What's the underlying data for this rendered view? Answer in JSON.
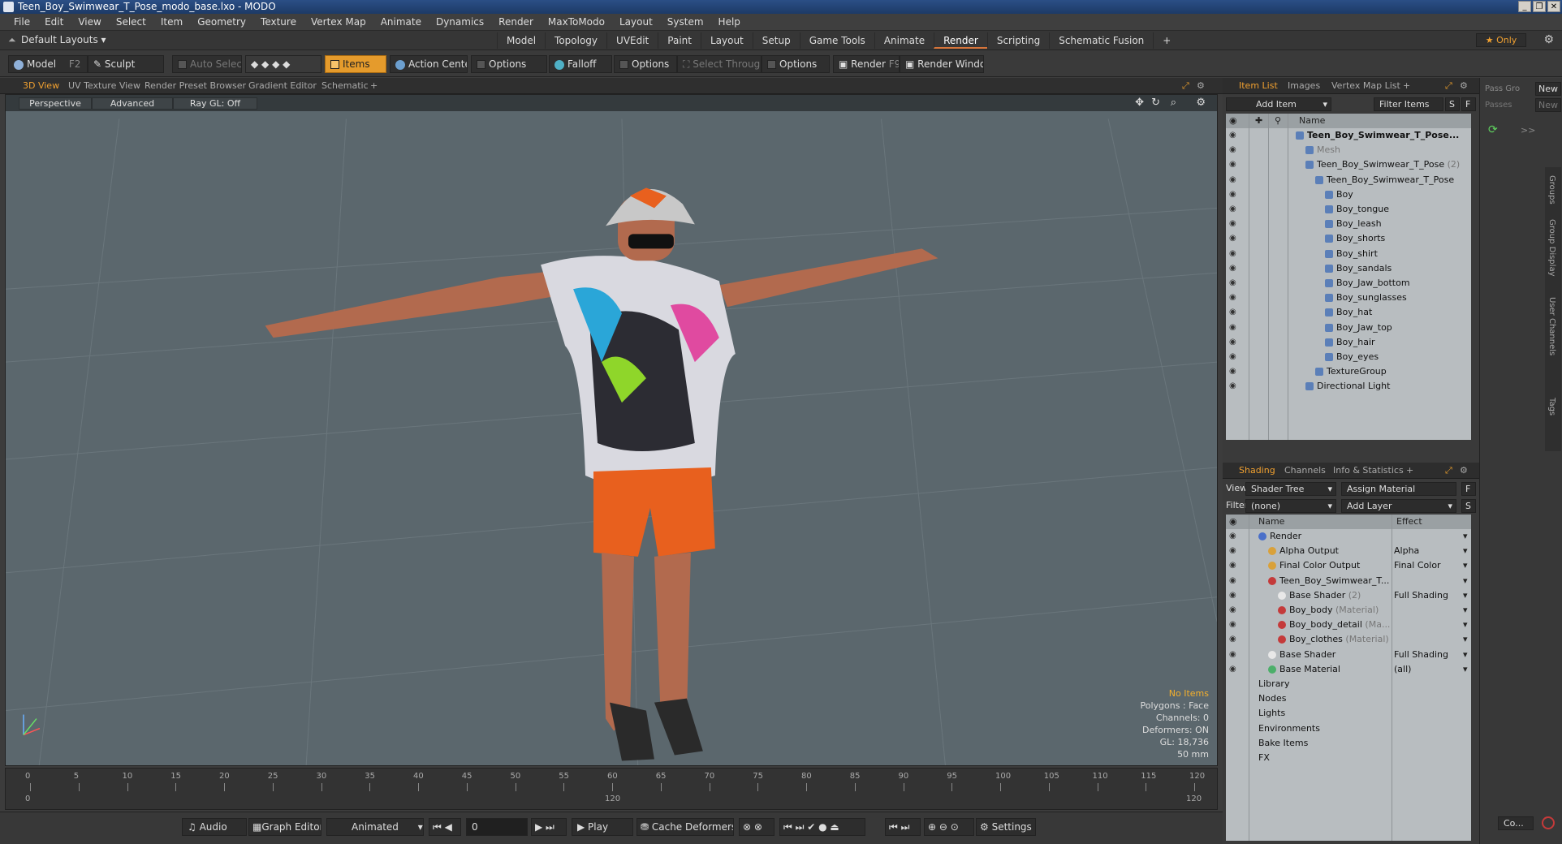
{
  "window": {
    "title": "Teen_Boy_Swimwear_T_Pose_modo_base.lxo - MODO",
    "controls": [
      "_",
      "❐",
      "✕"
    ]
  },
  "menu": [
    "File",
    "Edit",
    "View",
    "Select",
    "Item",
    "Geometry",
    "Texture",
    "Vertex Map",
    "Animate",
    "Dynamics",
    "Render",
    "MaxToModo",
    "Layout",
    "System",
    "Help"
  ],
  "layout": {
    "default": "Default Layouts ▾",
    "tabs": [
      "Model",
      "Topology",
      "UVEdit",
      "Paint",
      "Layout",
      "Setup",
      "Game Tools",
      "Animate",
      "Render",
      "Scripting",
      "Schematic Fusion",
      "+"
    ],
    "active_tab": "Render",
    "only": "★  Only"
  },
  "toolbar": {
    "model": "Model",
    "model_key": "F2",
    "sculpt": "Sculpt",
    "auto_select": "Auto Select",
    "items": "Items",
    "action_center": "Action Center",
    "options1": "Options",
    "falloff": "Falloff",
    "options2": "Options",
    "select_through": "Select Through",
    "options3": "Options",
    "render": "Render",
    "render_key": "F9",
    "render_window": "Render Window"
  },
  "viewtabs": [
    "3D View",
    "UV Texture View",
    "Render Preset Browser",
    "Gradient Editor",
    "Schematic",
    "+"
  ],
  "viewport": {
    "perspective": "Perspective",
    "advanced": "Advanced",
    "raygl": "Ray GL: Off",
    "info": {
      "no_items": "No Items",
      "polygons": "Polygons : Face",
      "channels": "Channels: 0",
      "deformers": "Deformers: ON",
      "gl": "GL: 18,736",
      "focal": "50 mm"
    }
  },
  "timeline": {
    "ticks": [
      "0",
      "5",
      "10",
      "15",
      "20",
      "25",
      "30",
      "35",
      "40",
      "45",
      "50",
      "55",
      "60",
      "65",
      "70",
      "75",
      "80",
      "85",
      "90",
      "95",
      "100",
      "105",
      "110",
      "115",
      "120"
    ],
    "start": "0",
    "mid": "120",
    "end": "120"
  },
  "bottom": {
    "audio": "Audio",
    "graph_editor": "Graph Editor",
    "animated": "Animated",
    "frame": "0",
    "play": "Play",
    "cache_deformers": "Cache Deformers",
    "settings": "Settings"
  },
  "item_list": {
    "tabs": [
      "Item List",
      "Images",
      "Vertex Map List",
      "+"
    ],
    "add_item": "Add Item",
    "filter_items": "Filter Items",
    "s": "S",
    "f": "F",
    "col_name": "Name",
    "items": [
      {
        "label": "Teen_Boy_Swimwear_T_Pose...",
        "suffix": "",
        "indent": 0,
        "bold": true
      },
      {
        "label": "Mesh",
        "suffix": "",
        "indent": 1,
        "dim": true
      },
      {
        "label": "Teen_Boy_Swimwear_T_Pose",
        "suffix": " (2)",
        "indent": 1
      },
      {
        "label": "Teen_Boy_Swimwear_T_Pose",
        "suffix": "",
        "indent": 2
      },
      {
        "label": "Boy",
        "suffix": "",
        "indent": 3
      },
      {
        "label": "Boy_tongue",
        "suffix": "",
        "indent": 3
      },
      {
        "label": "Boy_leash",
        "suffix": "",
        "indent": 3
      },
      {
        "label": "Boy_shorts",
        "suffix": "",
        "indent": 3
      },
      {
        "label": "Boy_shirt",
        "suffix": "",
        "indent": 3
      },
      {
        "label": "Boy_sandals",
        "suffix": "",
        "indent": 3
      },
      {
        "label": "Boy_Jaw_bottom",
        "suffix": "",
        "indent": 3
      },
      {
        "label": "Boy_sunglasses",
        "suffix": "",
        "indent": 3
      },
      {
        "label": "Boy_hat",
        "suffix": "",
        "indent": 3
      },
      {
        "label": "Boy_Jaw_top",
        "suffix": "",
        "indent": 3
      },
      {
        "label": "Boy_hair",
        "suffix": "",
        "indent": 3
      },
      {
        "label": "Boy_eyes",
        "suffix": "",
        "indent": 3
      },
      {
        "label": "TextureGroup",
        "suffix": "",
        "indent": 2
      },
      {
        "label": "Directional Light",
        "suffix": "",
        "indent": 1
      }
    ]
  },
  "shading": {
    "tabs": [
      "Shading",
      "Channels",
      "Info & Statistics",
      "+"
    ],
    "view_label": "View",
    "view_value": "Shader Tree",
    "assign_material": "Assign Material",
    "filter_label": "Filter",
    "filter_value": "(none)",
    "add_layer": "Add Layer",
    "f": "F",
    "s": "S",
    "col_name": "Name",
    "col_effect": "Effect",
    "rows": [
      {
        "label": "Render",
        "suffix": "",
        "effect": "",
        "indent": 0,
        "color": "#4a6fc9"
      },
      {
        "label": "Alpha Output",
        "suffix": "",
        "effect": "Alpha",
        "indent": 1,
        "color": "#d9a13a"
      },
      {
        "label": "Final Color Output",
        "suffix": "",
        "effect": "Final Color",
        "indent": 1,
        "color": "#d9a13a"
      },
      {
        "label": "Teen_Boy_Swimwear_T...",
        "suffix": "",
        "effect": "",
        "indent": 1,
        "color": "#c43a3a"
      },
      {
        "label": "Base Shader",
        "suffix": " (2)",
        "effect": "Full Shading",
        "indent": 2,
        "color": "#e8e8e8"
      },
      {
        "label": "Boy_body",
        "suffix": " (Material)",
        "effect": "",
        "indent": 2,
        "color": "#c43a3a"
      },
      {
        "label": "Boy_body_detail",
        "suffix": " (Ma...",
        "effect": "",
        "indent": 2,
        "color": "#c43a3a"
      },
      {
        "label": "Boy_clothes",
        "suffix": " (Material)",
        "effect": "",
        "indent": 2,
        "color": "#c43a3a"
      },
      {
        "label": "Base Shader",
        "suffix": "",
        "effect": "Full Shading",
        "indent": 1,
        "color": "#e8e8e8"
      },
      {
        "label": "Base Material",
        "suffix": "",
        "effect": "(all)",
        "indent": 1,
        "color": "#4caf6a"
      },
      {
        "label": "Library",
        "suffix": "",
        "effect": "",
        "indent": 0,
        "color": ""
      },
      {
        "label": "Nodes",
        "suffix": "",
        "effect": "",
        "indent": 0,
        "color": ""
      },
      {
        "label": "Lights",
        "suffix": "",
        "effect": "",
        "indent": 0,
        "color": ""
      },
      {
        "label": "Environments",
        "suffix": "",
        "effect": "",
        "indent": 0,
        "color": ""
      },
      {
        "label": "Bake Items",
        "suffix": "",
        "effect": "",
        "indent": 0,
        "color": ""
      },
      {
        "label": "FX",
        "suffix": "",
        "effect": "",
        "indent": 0,
        "color": ""
      }
    ]
  },
  "far_right": {
    "pass_group": "Pass Gro",
    "passes": "Passes",
    "new": "New",
    "side_tabs": [
      "Groups",
      "Group Display",
      "User Channels",
      "Tags"
    ],
    "co": "Co..."
  }
}
